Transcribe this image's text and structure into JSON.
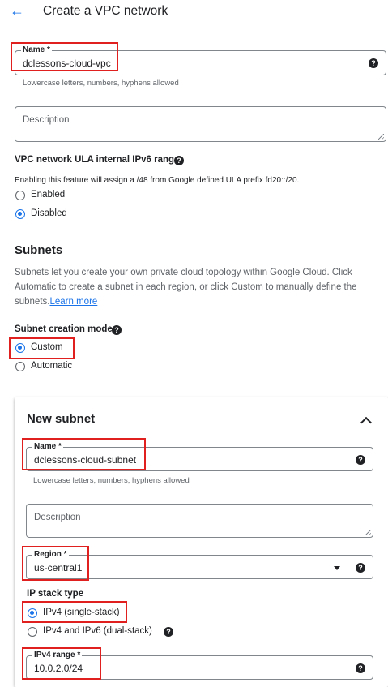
{
  "header": {
    "back_icon": "←",
    "title": "Create a VPC network"
  },
  "vpc": {
    "name_label": "Name *",
    "name_value": "dclessons-cloud-vpc",
    "name_hint": "Lowercase letters, numbers, hyphens allowed",
    "description_placeholder": "Description",
    "ula_title": "VPC network ULA internal IPv6 range",
    "ula_desc": "Enabling this feature will assign a /48 from Google defined ULA prefix fd20::/20.",
    "ula_options": [
      "Enabled",
      "Disabled"
    ],
    "ula_selected": "Disabled"
  },
  "subnets": {
    "title": "Subnets",
    "desc_line1": "Subnets let you create your own private cloud topology within Google Cloud. Click",
    "desc_line2": "Automatic to create a subnet in each region, or click Custom to manually define the",
    "desc_line3": "subnets.",
    "learn_more": "Learn more",
    "mode_label": "Subnet creation mode",
    "mode_options": [
      "Custom",
      "Automatic"
    ],
    "mode_selected": "Custom"
  },
  "new_subnet": {
    "title": "New subnet",
    "name_label": "Name *",
    "name_value": "dclessons-cloud-subnet",
    "name_hint": "Lowercase letters, numbers, hyphens allowed",
    "description_placeholder": "Description",
    "region_label": "Region *",
    "region_value": "us-central1",
    "ip_stack_label": "IP stack type",
    "ip_stack_options": [
      "IPv4 (single-stack)",
      "IPv4 and IPv6 (dual-stack)"
    ],
    "ip_stack_selected": "IPv4 (single-stack)",
    "ipv4_range_label": "IPv4 range *",
    "ipv4_range_value": "10.0.2.0/24"
  },
  "help_icon": "?",
  "colors": {
    "accent": "#1a73e8",
    "highlight": "#e01f1f",
    "border": "#80868b"
  }
}
